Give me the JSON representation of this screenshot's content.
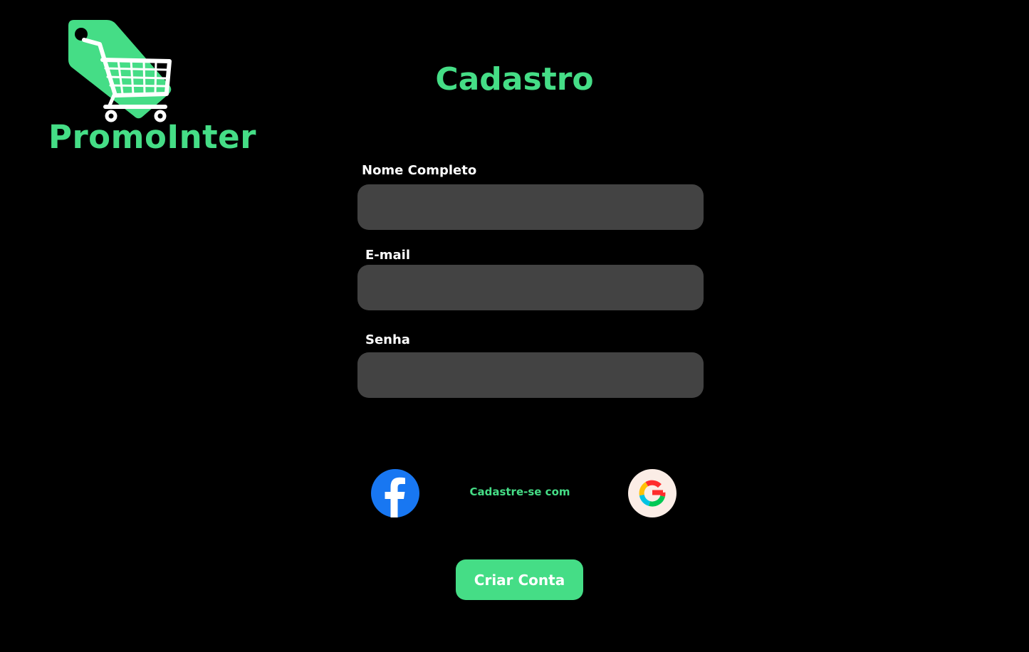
{
  "brand": {
    "name": "PromoInter",
    "logo_icon": "shopping-cart-price-tag-icon",
    "accent_color": "#45DD86"
  },
  "page": {
    "title": "Cadastro",
    "background_color": "#000000"
  },
  "form": {
    "full_name": {
      "label": "Nome Completo",
      "value": "",
      "placeholder": ""
    },
    "email": {
      "label": "E-mail",
      "value": "",
      "placeholder": ""
    },
    "password": {
      "label": "Senha",
      "value": "",
      "placeholder": ""
    },
    "input_background": "#434343"
  },
  "social": {
    "prompt": "Cadastre-se com",
    "facebook_icon": "facebook-icon",
    "google_icon": "google-icon"
  },
  "submit": {
    "label": "Criar Conta"
  }
}
